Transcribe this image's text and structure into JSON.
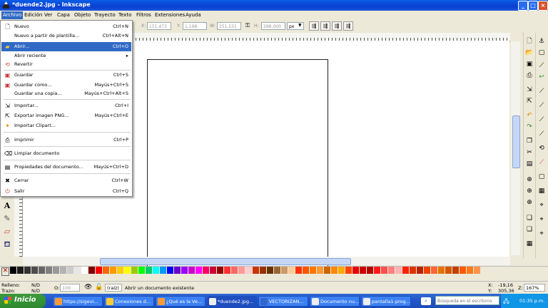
{
  "window": {
    "title": "*duende2.jpg - Inkscape"
  },
  "menubar": [
    "Archivo",
    "Edición",
    "Ver",
    "Capa",
    "Objeto",
    "Trayecto",
    "Texto",
    "Filtros",
    "Extensiones",
    "Ayuda"
  ],
  "file_menu": [
    {
      "label": "Nuevo",
      "shortcut": "Ctrl+N",
      "icon": "new-doc-icon"
    },
    {
      "label": "Nuevo a partir de plantilla...",
      "shortcut": "Ctrl+Alt+N",
      "icon": ""
    },
    {
      "label": "Abrir...",
      "shortcut": "Ctrl+O",
      "icon": "folder-icon",
      "highlighted": true
    },
    {
      "label": "Abrir reciente",
      "shortcut": "▸",
      "icon": ""
    },
    {
      "label": "Revertir",
      "shortcut": "",
      "icon": "revert-icon"
    },
    {
      "label": "Guardar",
      "shortcut": "Ctrl+S",
      "icon": "save-icon"
    },
    {
      "label": "Guardar como...",
      "shortcut": "Mayús+Ctrl+S",
      "icon": "save-as-icon"
    },
    {
      "label": "Guardar una copia...",
      "shortcut": "Mayús+Ctrl+Alt+S",
      "icon": ""
    },
    {
      "label": "Importar...",
      "shortcut": "Ctrl+I",
      "icon": "import-icon"
    },
    {
      "label": "Exportar imagen PNG...",
      "shortcut": "Mayús+Ctrl+E",
      "icon": "export-icon"
    },
    {
      "label": "Importar Clipart...",
      "shortcut": "",
      "icon": "clipart-icon"
    },
    {
      "label": "Imprimir",
      "shortcut": "Ctrl+P",
      "icon": "printer-icon"
    },
    {
      "label": "Limpiar documento",
      "shortcut": "",
      "icon": "broom-icon"
    },
    {
      "label": "Propiedades del documento...",
      "shortcut": "Mayús+Ctrl+D",
      "icon": "properties-icon"
    },
    {
      "label": "Cerrar",
      "shortcut": "Ctrl+W",
      "icon": "close-icon"
    },
    {
      "label": "Salir",
      "shortcut": "Ctrl+Q",
      "icon": "quit-icon"
    }
  ],
  "toolbar": {
    "x_label": "X:",
    "x_value": "151,473",
    "y_label": "Y:",
    "y_value": "1,198",
    "w_label": "W:",
    "w_value": "251,531",
    "h_label": "H:",
    "h_value": "288,000",
    "unit": "px"
  },
  "status": {
    "fill_label": "Relleno:",
    "fill_value": "N/D",
    "stroke_label": "Trazo:",
    "stroke_value": "N/D",
    "opacity_label": "O:",
    "opacity_value": "100",
    "layer": "(raíz)",
    "message": "Abrir un documento existente",
    "x_label": "X:",
    "x_value": "-19,16",
    "y_label": "Y:",
    "y_value": "305,36",
    "zoom_label": "Z:",
    "zoom_value": "167%"
  },
  "taskbar": {
    "start": "Inicio",
    "buttons": [
      "https://sigevi...",
      "Conexiones d...",
      "¿Qué es la Ve...",
      "*duende2.jpg...",
      "VECTORIZAN...",
      "Documento nu...",
      "pantalla1-prog..."
    ],
    "search_placeholder": "Búsqueda en el escritorio",
    "clock": "01:35 p.m."
  },
  "palette_colors": [
    "#000000",
    "#1a1a1a",
    "#333333",
    "#4d4d4d",
    "#666666",
    "#808080",
    "#999999",
    "#b3b3b3",
    "#cccccc",
    "#e6e6e6",
    "#ffffff",
    "#800000",
    "#ff0000",
    "#ff6600",
    "#ff9900",
    "#ffcc00",
    "#ffff00",
    "#99cc00",
    "#00ff00",
    "#00cc66",
    "#00ffff",
    "#0099ff",
    "#0000ff",
    "#6600cc",
    "#9900ff",
    "#cc00cc",
    "#ff00ff",
    "#ff0066",
    "#cc0033",
    "#990000",
    "#ff3333",
    "#ff6666",
    "#ff9999",
    "#ffcccc",
    "#cc3300",
    "#993300",
    "#663300",
    "#996633",
    "#cc9966",
    "#ffcc99",
    "#ff3300",
    "#ff5500",
    "#ff7700",
    "#ff9933",
    "#cc6600",
    "#ff8800",
    "#ffaa00",
    "#ff4400",
    "#e60000",
    "#cc0000",
    "#b30000",
    "#ff1a1a",
    "#ff4d4d",
    "#ff8080",
    "#ffb3b3",
    "#ff2200",
    "#dd3300",
    "#bb2200",
    "#ee4400",
    "#ff6633",
    "#e67300",
    "#d45500",
    "#c04000",
    "#ff5a00",
    "#ff7a1a",
    "#ff944d"
  ]
}
